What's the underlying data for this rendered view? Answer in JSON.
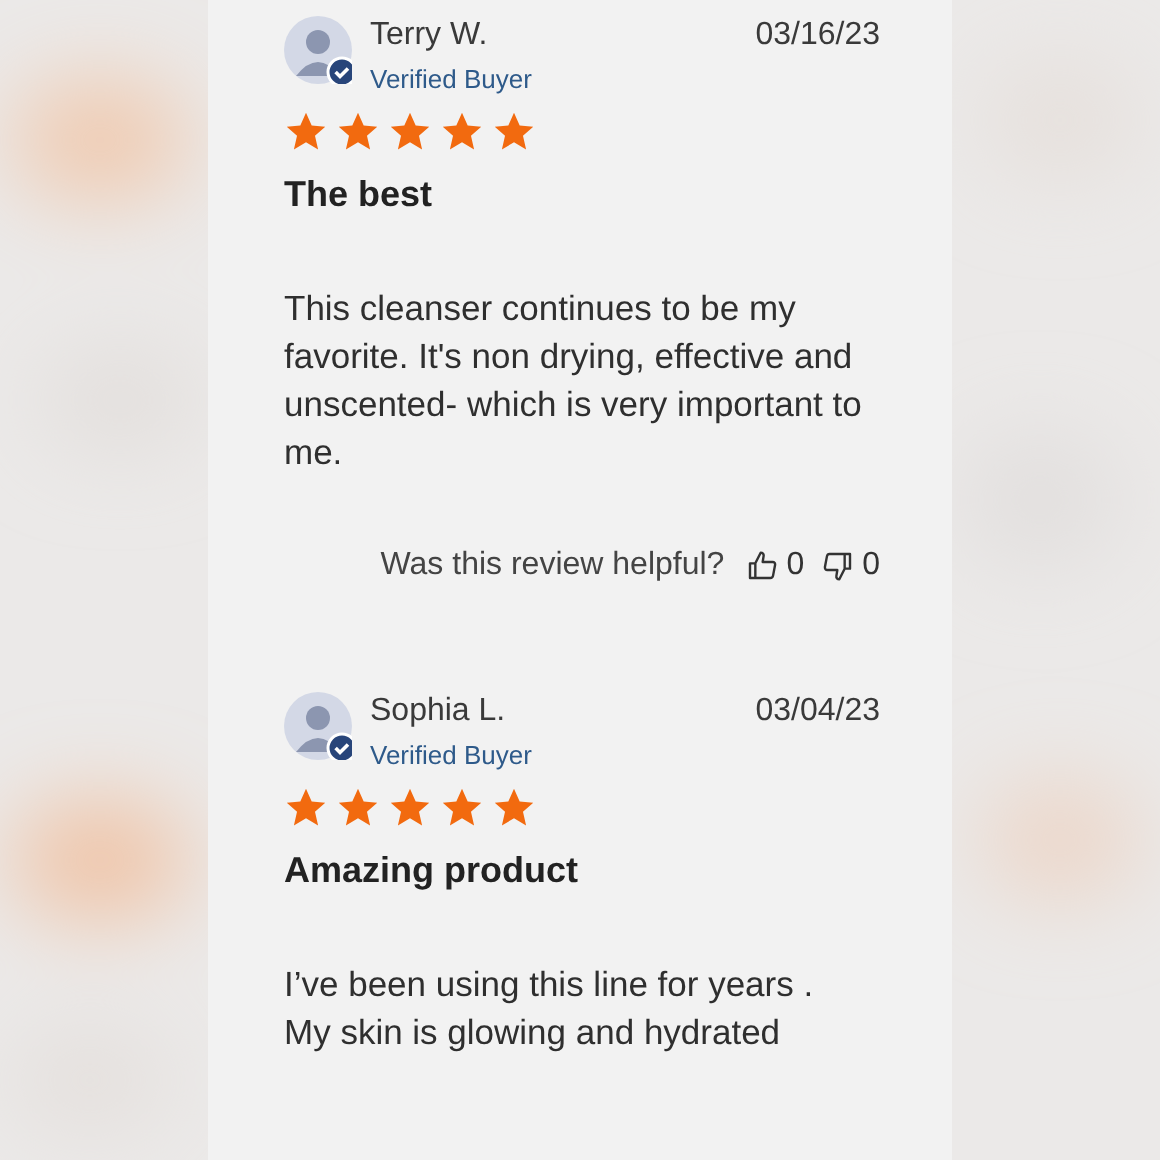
{
  "reviews": [
    {
      "author": "Terry W.",
      "badge": "Verified Buyer",
      "date": "03/16/23",
      "stars": 5,
      "title": "The best",
      "body": "This cleanser continues to be my favorite. It's non drying, effective and unscented- which is very important to me.",
      "helpful": {
        "question": "Was this review helpful?",
        "up": "0",
        "down": "0"
      }
    },
    {
      "author": "Sophia L.",
      "badge": "Verified Buyer",
      "date": "03/04/23",
      "stars": 5,
      "title": "Amazing product",
      "body": "I’ve been using this line for years .\nMy skin is glowing and hydrated"
    }
  ]
}
